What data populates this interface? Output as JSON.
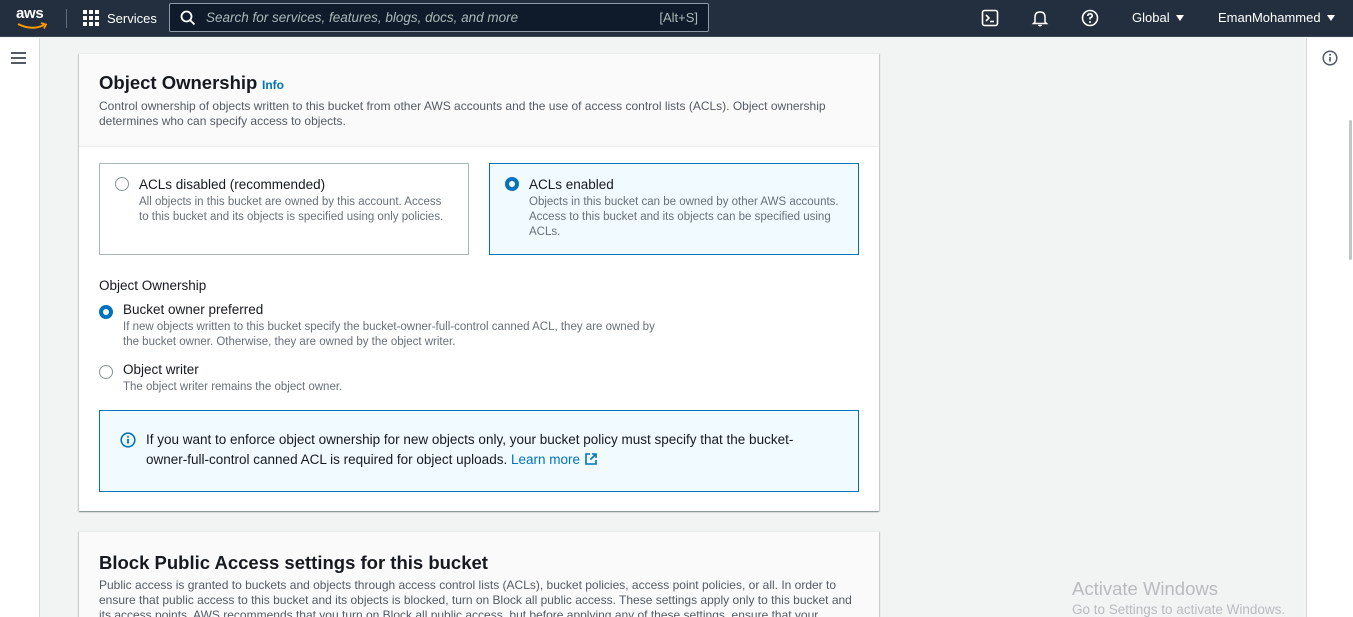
{
  "nav": {
    "logo_text": "aws",
    "services_label": "Services",
    "search_placeholder": "Search for services, features, blogs, docs, and more",
    "search_shortcut": "[Alt+S]",
    "region": "Global",
    "user": "EmanMohammed",
    "icons": [
      "cloudshell-icon",
      "bell-icon",
      "help-icon"
    ]
  },
  "object_ownership": {
    "title": "Object Ownership",
    "info": "Info",
    "description": "Control ownership of objects written to this bucket from other AWS accounts and the use of access control lists (ACLs). Object ownership determines who can specify access to objects.",
    "tiles": [
      {
        "label": "ACLs disabled (recommended)",
        "description": "All objects in this bucket are owned by this account. Access to this bucket and its objects is specified using only policies.",
        "selected": false
      },
      {
        "label": "ACLs enabled",
        "description": "Objects in this bucket can be owned by other AWS accounts. Access to this bucket and its objects can be specified using ACLs.",
        "selected": true
      }
    ],
    "field_label": "Object Ownership",
    "options": [
      {
        "label": "Bucket owner preferred",
        "description": "If new objects written to this bucket specify the bucket-owner-full-control canned ACL, they are owned by the bucket owner. Otherwise, they are owned by the object writer.",
        "selected": true
      },
      {
        "label": "Object writer",
        "description": "The object writer remains the object owner.",
        "selected": false
      }
    ],
    "alert": {
      "text": "If you want to enforce object ownership for new objects only, your bucket policy must specify that the bucket-owner-full-control canned ACL is required for object uploads.",
      "link": "Learn more"
    }
  },
  "block_public_access": {
    "title": "Block Public Access settings for this bucket",
    "description": "Public access is granted to buckets and objects through access control lists (ACLs), bucket policies, access point policies, or all. In order to ensure that public access to this bucket and its objects is blocked, turn on Block all public access. These settings apply only to this bucket and its access points. AWS recommends that you turn on Block all public access, but before applying any of these settings, ensure that your"
  },
  "watermark": {
    "line1": "Activate Windows",
    "line2": "Go to Settings to activate Windows."
  },
  "colors": {
    "nav_bg": "#232f3e",
    "accent": "#0073bb",
    "orange": "#ff9900"
  }
}
